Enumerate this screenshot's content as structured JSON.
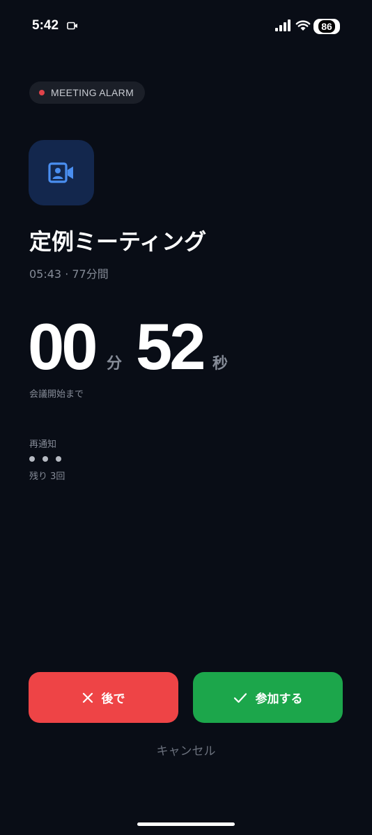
{
  "status_bar": {
    "time": "5:42",
    "battery": "86"
  },
  "alarm": {
    "badge_label": "MEETING ALARM",
    "title": "定例ミーティング",
    "subtitle": "05:43 · 77分間"
  },
  "countdown": {
    "minutes": "00",
    "minutes_unit": "分",
    "seconds": "52",
    "seconds_unit": "秒",
    "caption": "会議開始まで"
  },
  "snooze": {
    "label": "再通知",
    "remaining": "残り 3回"
  },
  "actions": {
    "later_label": "後で",
    "join_label": "参加する",
    "cancel_label": "キャンセル"
  },
  "colors": {
    "background": "#090d16",
    "later": "#ee4446",
    "join": "#1ca64b",
    "badge_dot": "#e0434a",
    "icon_bg": "#13274d",
    "icon_fg": "#4a8ef0"
  },
  "icons": {
    "app": "video-call-icon",
    "later": "close-icon",
    "join": "check-icon"
  }
}
